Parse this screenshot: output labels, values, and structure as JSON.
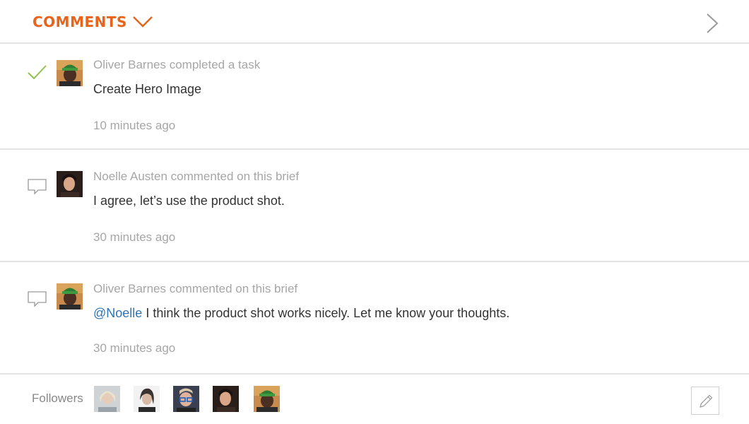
{
  "header": {
    "title": "COMMENTS",
    "accent_color": "#e8641c",
    "collapse_icon": "chevron-down-icon",
    "next_icon": "chevron-right-icon"
  },
  "activity": [
    {
      "type": "task-completed",
      "icon": "checkmark-icon",
      "author": "Oliver Barnes",
      "meta": "Oliver Barnes completed a task",
      "body": "Create Hero Image",
      "time": "10 minutes ago"
    },
    {
      "type": "comment",
      "icon": "comment-icon",
      "author": "Noelle Austen",
      "meta": "Noelle Austen commented on this brief",
      "body": "I agree, let’s use the product shot.",
      "time": "30 minutes ago"
    },
    {
      "type": "comment",
      "icon": "comment-icon",
      "author": "Oliver Barnes",
      "meta": "Oliver Barnes commented on this brief",
      "mention": "@Noelle",
      "body": " I think the product shot works nicely. Let me know your thoughts.",
      "time": "30 minutes ago"
    }
  ],
  "footer": {
    "followers_label": "Followers",
    "edit_icon": "pencil-icon"
  },
  "colors": {
    "check": "#8cc34a",
    "mention": "#2b75b8",
    "muted_text": "#a6a6a6",
    "divider": "#e3e3e3"
  }
}
